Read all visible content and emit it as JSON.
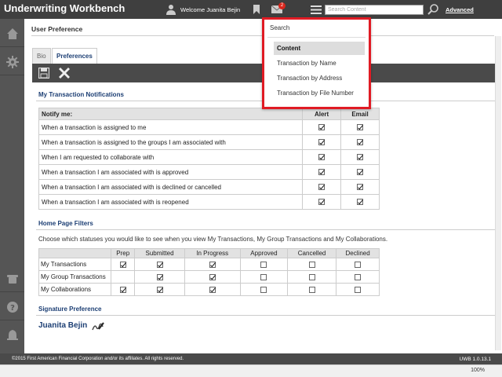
{
  "app": {
    "title": "Underwriting Workbench"
  },
  "header": {
    "welcome": "Welcome Juanita Bejin",
    "notification_count": "2",
    "search_placeholder": "Search Content",
    "advanced_label": "Advanced"
  },
  "search_dropdown": {
    "header": "Search",
    "items": [
      "Content",
      "Transaction by Name",
      "Transaction by Address",
      "Transaction by File Number"
    ],
    "selected": "Content"
  },
  "page": {
    "title": "User Preference",
    "tabs": [
      "Bio",
      "Preferences"
    ],
    "active_tab": "Preferences"
  },
  "notifications": {
    "title": "My Transaction Notifications",
    "headers": {
      "notify": "Notify me:",
      "alert": "Alert",
      "email": "Email"
    },
    "rows": [
      {
        "label": "When a transaction is assigned to me",
        "alert": true,
        "email": true
      },
      {
        "label": "When a transaction is assigned to the groups I am associated with",
        "alert": true,
        "email": true
      },
      {
        "label": "When I am requested to collaborate with",
        "alert": true,
        "email": true
      },
      {
        "label": "When a transaction I am associated with is approved",
        "alert": true,
        "email": true
      },
      {
        "label": "When a transaction I am associated with is declined or cancelled",
        "alert": true,
        "email": true
      },
      {
        "label": "When a transaction I am associated with is reopened",
        "alert": true,
        "email": true
      }
    ]
  },
  "filters": {
    "title": "Home Page Filters",
    "description": "Choose which statuses you would like to see when you view My Transactions, My Group Transactions and My Collaborations.",
    "columns": [
      "Prep",
      "Submitted",
      "In Progress",
      "Approved",
      "Cancelled",
      "Declined"
    ],
    "rows": [
      {
        "label": "My Transactions",
        "values": [
          true,
          true,
          true,
          false,
          false,
          false
        ]
      },
      {
        "label": "My Group Transactions",
        "values": [
          false,
          true,
          true,
          false,
          false,
          false
        ]
      },
      {
        "label": "My Collaborations",
        "values": [
          true,
          true,
          true,
          false,
          false,
          false
        ]
      }
    ]
  },
  "signature": {
    "title": "Signature Preference",
    "name": "Juanita Bejin"
  },
  "footer": {
    "copyright": "©2015 First American Financial Corporation and/or its affiliates. All rights reserved.",
    "version": "UWB 1.0.13.1"
  },
  "statusbar": {
    "zoom": "100%"
  },
  "colors": {
    "header_bg": "#3f3f3f",
    "accent_blue": "#1d3f74",
    "highlight_red": "#e01b24",
    "badge_red": "#d9261c"
  }
}
